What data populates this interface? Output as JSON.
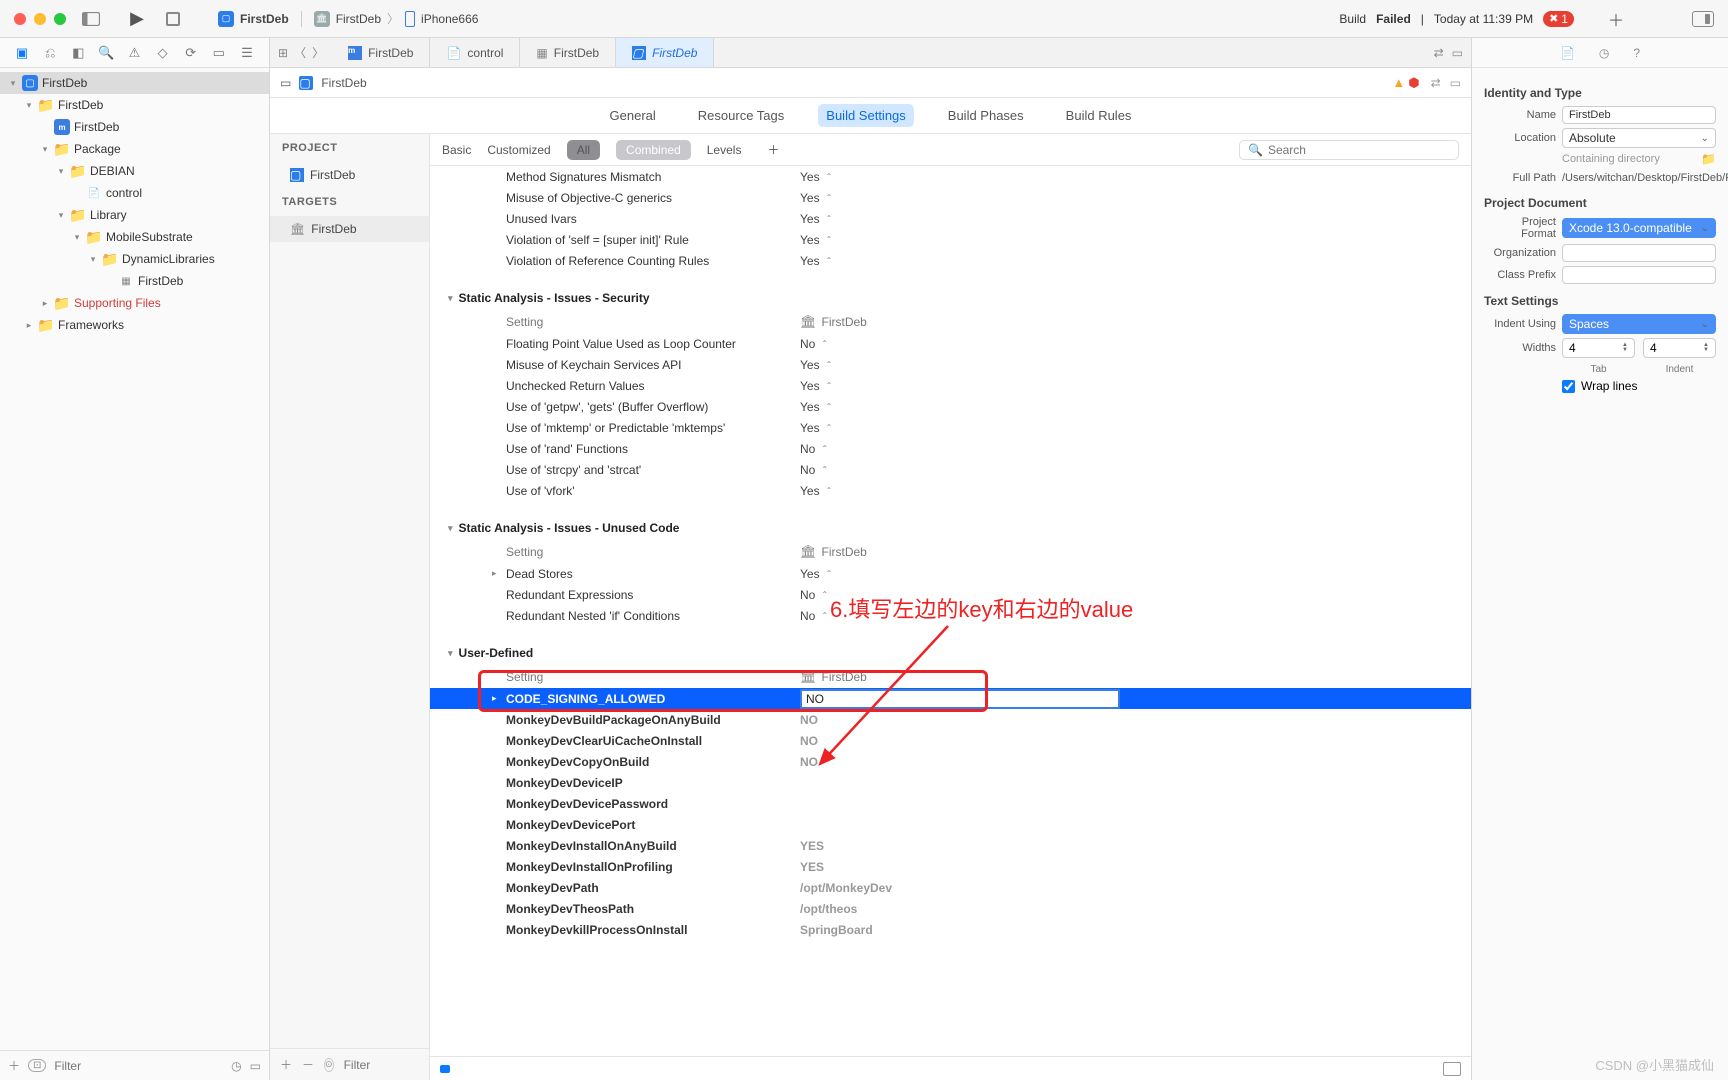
{
  "titlebar": {
    "project": "FirstDeb",
    "scheme_target": "FirstDeb",
    "scheme_device": "iPhone666",
    "status_prefix": "Build",
    "status_word": "Failed",
    "status_time": "Today at 11:39 PM",
    "error_count": "1"
  },
  "tabs": [
    {
      "label": "FirstDeb",
      "icon": "m"
    },
    {
      "label": "control",
      "icon": "file"
    },
    {
      "label": "FirstDeb",
      "icon": "grid"
    },
    {
      "label": "FirstDeb",
      "icon": "proj",
      "active": true
    }
  ],
  "jumpbar": {
    "crumb": "FirstDeb"
  },
  "segments": [
    "General",
    "Resource Tags",
    "Build Settings",
    "Build Phases",
    "Build Rules"
  ],
  "segment_active": "Build Settings",
  "sidebar2": {
    "project_hdr": "PROJECT",
    "project_item": "FirstDeb",
    "targets_hdr": "TARGETS",
    "target_item": "FirstDeb",
    "filter_placeholder": "Filter"
  },
  "filterbar": {
    "items": [
      "Basic",
      "Customized",
      "All",
      "Combined",
      "Levels"
    ],
    "search_placeholder": "Search"
  },
  "navigator": {
    "root": "FirstDeb",
    "items": [
      {
        "indent": 1,
        "disc": "▾",
        "icon": "folder",
        "label": "FirstDeb"
      },
      {
        "indent": 2,
        "disc": "",
        "icon": "m",
        "label": "FirstDeb"
      },
      {
        "indent": 2,
        "disc": "▾",
        "icon": "folder",
        "label": "Package"
      },
      {
        "indent": 3,
        "disc": "▾",
        "icon": "folder",
        "label": "DEBIAN"
      },
      {
        "indent": 4,
        "disc": "",
        "icon": "file",
        "label": "control"
      },
      {
        "indent": 3,
        "disc": "▾",
        "icon": "folder",
        "label": "Library"
      },
      {
        "indent": 4,
        "disc": "▾",
        "icon": "folder",
        "label": "MobileSubstrate"
      },
      {
        "indent": 5,
        "disc": "▾",
        "icon": "folder",
        "label": "DynamicLibraries"
      },
      {
        "indent": 6,
        "disc": "",
        "icon": "grid",
        "label": "FirstDeb"
      },
      {
        "indent": 2,
        "disc": "▸",
        "icon": "folder",
        "label": "Supporting Files",
        "red": true
      },
      {
        "indent": 1,
        "disc": "▸",
        "icon": "folder",
        "label": "Frameworks"
      }
    ],
    "filter_placeholder": "Filter"
  },
  "settings": {
    "top_rows": [
      {
        "k": "Method Signatures Mismatch",
        "v": "Yes"
      },
      {
        "k": "Misuse of Objective-C generics",
        "v": "Yes"
      },
      {
        "k": "Unused Ivars",
        "v": "Yes"
      },
      {
        "k": "Violation of 'self = [super init]' Rule",
        "v": "Yes"
      },
      {
        "k": "Violation of Reference Counting Rules",
        "v": "Yes"
      }
    ],
    "group_security": "Static Analysis - Issues - Security",
    "setting_label": "Setting",
    "col_target": "FirstDeb",
    "security_rows": [
      {
        "k": "Floating Point Value Used as Loop Counter",
        "v": "No"
      },
      {
        "k": "Misuse of Keychain Services API",
        "v": "Yes"
      },
      {
        "k": "Unchecked Return Values",
        "v": "Yes"
      },
      {
        "k": "Use of 'getpw', 'gets' (Buffer Overflow)",
        "v": "Yes"
      },
      {
        "k": "Use of 'mktemp' or Predictable 'mktemps'",
        "v": "Yes"
      },
      {
        "k": "Use of 'rand' Functions",
        "v": "No"
      },
      {
        "k": "Use of 'strcpy' and 'strcat'",
        "v": "No"
      },
      {
        "k": "Use of 'vfork'",
        "v": "Yes"
      }
    ],
    "group_unused": "Static Analysis - Issues - Unused Code",
    "unused_rows": [
      {
        "k": "Dead Stores",
        "v": "Yes",
        "disc": true
      },
      {
        "k": "Redundant Expressions",
        "v": "No"
      },
      {
        "k": "Redundant Nested 'if' Conditions",
        "v": "No"
      }
    ],
    "group_user": "User-Defined",
    "user_selected": {
      "k": "CODE_SIGNING_ALLOWED",
      "v": "NO"
    },
    "user_rows": [
      {
        "k": "MonkeyDevBuildPackageOnAnyBuild",
        "v": "NO",
        "grey": true
      },
      {
        "k": "MonkeyDevClearUiCacheOnInstall",
        "v": "NO",
        "grey": true
      },
      {
        "k": "MonkeyDevCopyOnBuild",
        "v": "NO",
        "grey": true
      },
      {
        "k": "MonkeyDevDeviceIP",
        "v": ""
      },
      {
        "k": "MonkeyDevDevicePassword",
        "v": ""
      },
      {
        "k": "MonkeyDevDevicePort",
        "v": ""
      },
      {
        "k": "MonkeyDevInstallOnAnyBuild",
        "v": "YES",
        "grey": true
      },
      {
        "k": "MonkeyDevInstallOnProfiling",
        "v": "YES",
        "grey": true
      },
      {
        "k": "MonkeyDevPath",
        "v": "/opt/MonkeyDev",
        "grey": true
      },
      {
        "k": "MonkeyDevTheosPath",
        "v": "/opt/theos",
        "grey": true
      },
      {
        "k": "MonkeyDevkillProcessOnInstall",
        "v": "SpringBoard",
        "grey": true
      }
    ]
  },
  "inspector": {
    "sec1": "Identity and Type",
    "name_label": "Name",
    "name_value": "FirstDeb",
    "location_label": "Location",
    "location_value": "Absolute",
    "containing": "Containing directory",
    "fullpath_label": "Full Path",
    "fullpath_value": "/Users/witchan/Desktop/FirstDeb/FirstDeb.xcodeproj",
    "sec2": "Project Document",
    "format_label": "Project Format",
    "format_value": "Xcode 13.0-compatible",
    "org_label": "Organization",
    "prefix_label": "Class Prefix",
    "sec3": "Text Settings",
    "indent_label": "Indent Using",
    "indent_value": "Spaces",
    "widths_label": "Widths",
    "tab_value": "4",
    "indent_value2": "4",
    "tab_caption": "Tab",
    "indent_caption": "Indent",
    "wrap_label": "Wrap lines"
  },
  "annotation": {
    "text": "6.填写左边的key和右边的value"
  },
  "watermark": "CSDN @小黑猫成仙"
}
